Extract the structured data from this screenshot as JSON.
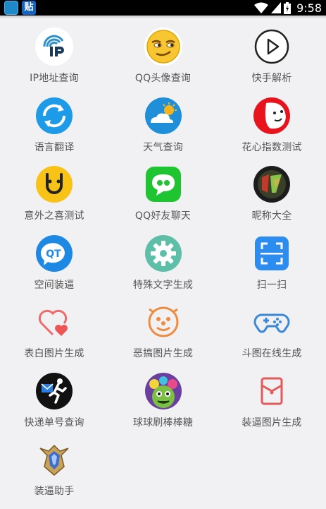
{
  "status_bar": {
    "app_badge": "贴",
    "time": "9:58"
  },
  "items": [
    {
      "label": "IP地址查询",
      "icon": "ip-icon"
    },
    {
      "label": "QQ头像查询",
      "icon": "smirk-emoji-icon"
    },
    {
      "label": "快手解析",
      "icon": "play-icon"
    },
    {
      "label": "语言翻译",
      "icon": "translate-refresh-icon"
    },
    {
      "label": "天气查询",
      "icon": "weather-icon"
    },
    {
      "label": "花心指数测试",
      "icon": "face-icon"
    },
    {
      "label": "意外之喜测试",
      "icon": "smile-face-icon"
    },
    {
      "label": "QQ好友聊天",
      "icon": "chat-icon"
    },
    {
      "label": "昵称大全",
      "icon": "game-logo-icon"
    },
    {
      "label": "空间装逼",
      "icon": "qt-icon"
    },
    {
      "label": "特殊文字生成",
      "icon": "gear-icon"
    },
    {
      "label": "扫一扫",
      "icon": "scan-icon"
    },
    {
      "label": "表白图片生成",
      "icon": "hearts-icon"
    },
    {
      "label": "恶搞图片生成",
      "icon": "clown-icon"
    },
    {
      "label": "斗图在线生成",
      "icon": "gamepad-icon"
    },
    {
      "label": "快递单号查询",
      "icon": "courier-icon"
    },
    {
      "label": "球球刷棒棒糖",
      "icon": "monster-icon"
    },
    {
      "label": "装逼图片生成",
      "icon": "envelope-icon"
    },
    {
      "label": "装逼助手",
      "icon": "badge-icon"
    }
  ]
}
